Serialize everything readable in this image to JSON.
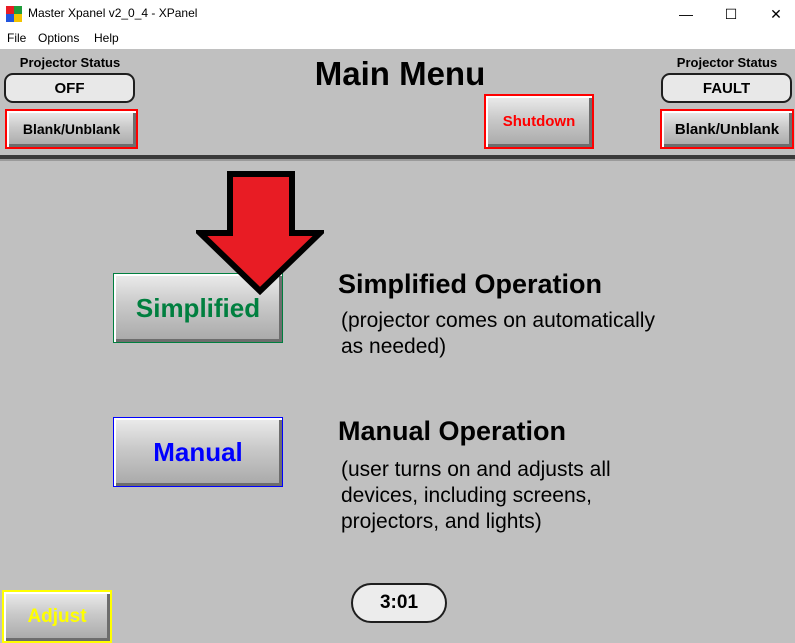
{
  "window": {
    "title": "Master Xpanel v2_0_4 - XPanel",
    "minimize_glyph": "—",
    "maximize_glyph": "☐",
    "close_glyph": "✕"
  },
  "menubar": {
    "items": [
      "File",
      "Options",
      "Help"
    ]
  },
  "header": {
    "title": "Main Menu",
    "left_projector": {
      "label": "Projector Status",
      "status": "OFF",
      "button": "Blank/Unblank"
    },
    "right_projector": {
      "label": "Projector Status",
      "status": "FAULT",
      "button": "Blank/Unblank"
    },
    "shutdown_button": "Shutdown"
  },
  "simplified": {
    "button": "Simplified",
    "heading": "Simplified Operation",
    "description_line1": "(projector comes on automatically",
    "description_line2": "as needed)"
  },
  "manual": {
    "button": "Manual",
    "heading": "Manual Operation",
    "description_line1": "(user turns on and adjusts all",
    "description_line2": "devices, including screens,",
    "description_line3": "projectors, and lights)"
  },
  "footer": {
    "adjust_button": "Adjust",
    "clock": "3:01"
  },
  "colors": {
    "panel_bg": "#c0c0c0",
    "red_accent": "#ff0000",
    "green_accent": "#007f3f",
    "blue_accent": "#0000ff",
    "yellow_accent": "#ffff00",
    "arrow_fill": "#e81c24"
  },
  "icons": {
    "app": "xpanel-app-icon",
    "arrow": "down-arrow-icon"
  }
}
